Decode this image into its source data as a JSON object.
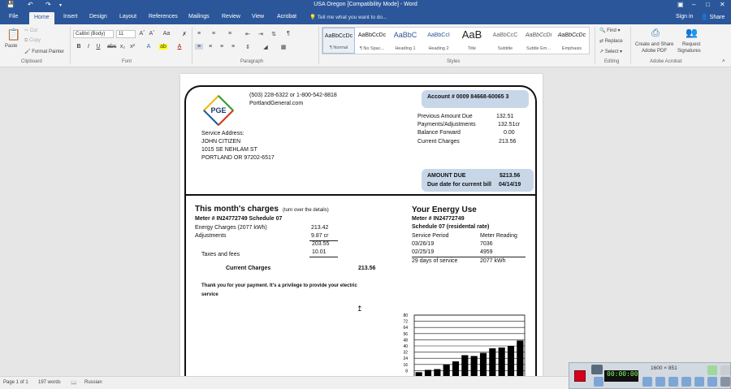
{
  "window": {
    "title": "USA Oregon [Compatibility Mode] - Word"
  },
  "quick_access": {
    "save_icon": "save-icon",
    "undo_icon": "undo-icon",
    "redo_icon": "redo-icon"
  },
  "tabs": [
    "File",
    "Home",
    "Insert",
    "Design",
    "Layout",
    "References",
    "Mailings",
    "Review",
    "View",
    "Acrobat"
  ],
  "active_tab": "Home",
  "tell_me": "Tell me what you want to do...",
  "account": {
    "signin": "Sign in",
    "share": "Share"
  },
  "ribbon": {
    "clipboard": {
      "label": "Clipboard",
      "paste": "Paste",
      "cut": "Cut",
      "copy": "Copy",
      "format_painter": "Format Painter"
    },
    "font": {
      "label": "Font",
      "name": "Calibri (Body)",
      "size": "11"
    },
    "paragraph": {
      "label": "Paragraph"
    },
    "styles": {
      "label": "Styles",
      "items": [
        {
          "sample": "AaBbCcDc",
          "name": "¶ Normal"
        },
        {
          "sample": "AaBbCcDc",
          "name": "¶ No Spac..."
        },
        {
          "sample": "AaBbC",
          "name": "Heading 1"
        },
        {
          "sample": "AaBbCcI",
          "name": "Heading 2"
        },
        {
          "sample": "AaB",
          "name": "Title"
        },
        {
          "sample": "AaBbCcC",
          "name": "Subtitle"
        },
        {
          "sample": "AaBbCcDi",
          "name": "Subtle Em..."
        },
        {
          "sample": "AaBbCcDc",
          "name": "Emphasis"
        }
      ]
    },
    "editing": {
      "label": "Editing",
      "find": "Find",
      "replace": "Replace",
      "select": "Select"
    },
    "acrobat": {
      "label": "Adobe Acrobat",
      "create_share": "Create and Share",
      "adobe_pdf": "Adobe PDF",
      "request": "Request",
      "signatures": "Signatures"
    }
  },
  "bill": {
    "logo": "PGE",
    "phone": "(503) 228-6322 or 1-800-542-8818",
    "website": "PortlandGeneral.com",
    "account": "Account #  0009 84668-60065 3",
    "service_address_label": "Service Address:",
    "name": "JOHN CITIZEN",
    "street": "1015 SE NEHLAM ST",
    "city": " PORTLAND OR 97202-6517",
    "summary": [
      {
        "label": "Previous Amount Due",
        "value": "132.51"
      },
      {
        "label": "Payments/Adjustments",
        "value": "132.51cr"
      },
      {
        "label": "Balance Forward",
        "value": "0.00"
      },
      {
        "label": "Current Charges",
        "value": "213.56"
      }
    ],
    "amount_due_label": "AMOUNT DUE",
    "amount_due": "$213.56",
    "due_date_label": "Due date for current bill",
    "due_date": "04/14/19",
    "charges": {
      "title": "This month's charges",
      "subtitle": "(turn over the details)",
      "meter": "Meter # IN24772749 Schedule 07",
      "energy_label": "Energy Charges (2077 kWh)",
      "energy": "213.42",
      "adjustments_label": "Adjustments",
      "adjustments": "9.87 cr",
      "subtotal": "203.55",
      "taxes_label": "Taxes and fees",
      "taxes": "10.01",
      "current_label": "Current Charges",
      "current": "213.56",
      "thanks_1": "Thank you for your payment. It's a privilege to provide your electric",
      "thanks_2": "service"
    },
    "energy": {
      "title": "Your Energy Use",
      "meter": "Meter # IN24772749",
      "schedule": "Schedule 07 (residental rate)",
      "col1": "Service Period",
      "col2": "Meter Reading",
      "rows": [
        {
          "date": "03/26/19",
          "reading": "7036"
        },
        {
          "date": "02/25/19",
          "reading": "4959"
        }
      ],
      "days": "29 days of service",
      "kwh": "2077 kWh"
    }
  },
  "chart_data": {
    "type": "bar",
    "y_ticks": [
      "80",
      "72",
      "64",
      "56",
      "48",
      "40",
      "32",
      "24",
      "16",
      "8"
    ],
    "ylim": [
      0,
      80
    ],
    "values": [
      6,
      9,
      10,
      16,
      20,
      28,
      27,
      31,
      37,
      38,
      40,
      47
    ]
  },
  "statusbar": {
    "page": "Page 1 of 1",
    "words": "197 words",
    "language": "Russian"
  },
  "recorder": {
    "timer": "00:00:00",
    "resolution": "1600 × 851"
  }
}
